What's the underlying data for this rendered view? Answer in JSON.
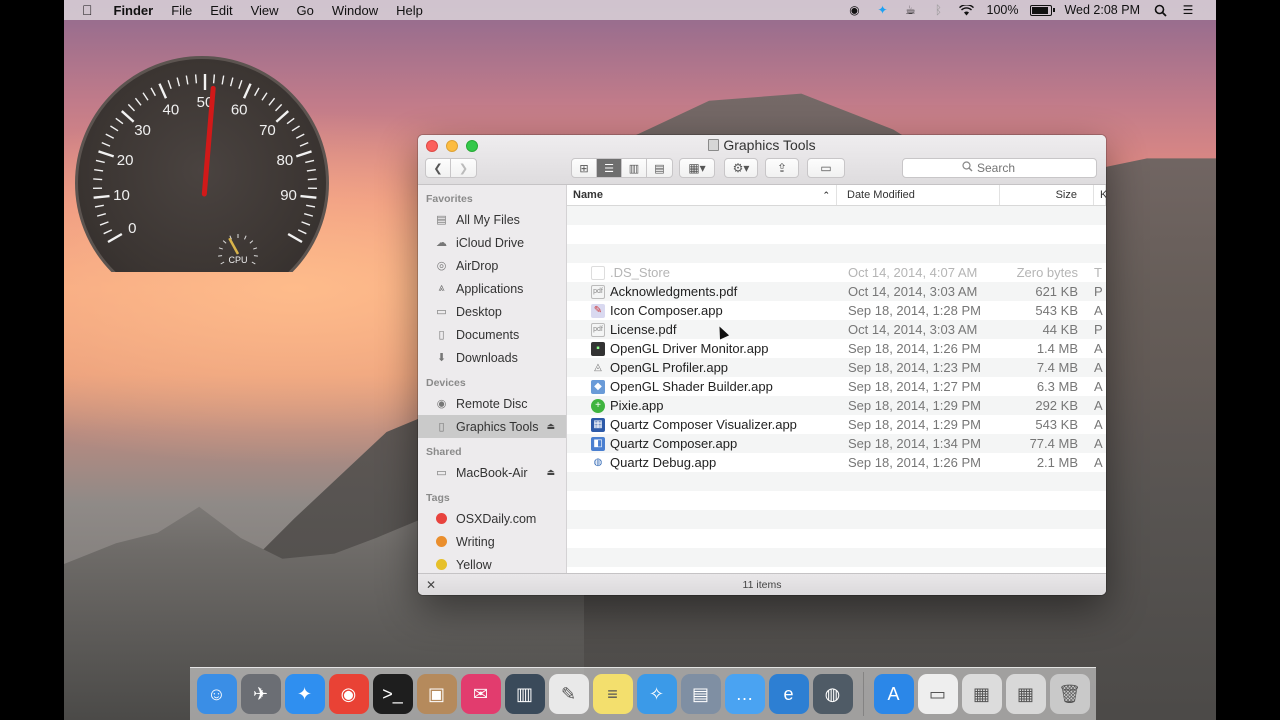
{
  "menubar": {
    "apple": "",
    "app": "Finder",
    "items": [
      "File",
      "Edit",
      "View",
      "Go",
      "Window",
      "Help"
    ],
    "battery": "100%",
    "clock": "Wed 2:08 PM"
  },
  "gauge": {
    "ticks": [
      "0",
      "10",
      "20",
      "30",
      "40",
      "50",
      "60",
      "70",
      "80",
      "90"
    ],
    "needle_value": 52,
    "sub_label": "CPU"
  },
  "finder": {
    "title": "Graphics Tools",
    "search_placeholder": "Search",
    "sidebar": {
      "favorites_header": "Favorites",
      "favorites": [
        {
          "label": "All My Files",
          "icon": "all-files-icon"
        },
        {
          "label": "iCloud Drive",
          "icon": "cloud-icon"
        },
        {
          "label": "AirDrop",
          "icon": "airdrop-icon"
        },
        {
          "label": "Applications",
          "icon": "applications-icon"
        },
        {
          "label": "Desktop",
          "icon": "desktop-icon"
        },
        {
          "label": "Documents",
          "icon": "documents-icon"
        },
        {
          "label": "Downloads",
          "icon": "downloads-icon"
        }
      ],
      "devices_header": "Devices",
      "devices": [
        {
          "label": "Remote Disc",
          "icon": "disc-icon"
        },
        {
          "label": "Graphics Tools",
          "icon": "disk-image-icon"
        }
      ],
      "shared_header": "Shared",
      "shared": [
        {
          "label": "MacBook-Air",
          "icon": "computer-icon"
        }
      ],
      "tags_header": "Tags",
      "tags": [
        {
          "label": "OSXDaily.com",
          "color": "#e8433e"
        },
        {
          "label": "Writing",
          "color": "#ea8e2d"
        },
        {
          "label": "Yellow",
          "color": "#e6c02a"
        }
      ]
    },
    "columns": {
      "name": "Name",
      "date": "Date Modified",
      "size": "Size",
      "kind": "K"
    },
    "files": [
      {
        "name": ".DS_Store",
        "date": "Oct 14, 2014, 4:07 AM",
        "size": "Zero bytes",
        "kind": "T"
      },
      {
        "name": "Acknowledgments.pdf",
        "date": "Oct 14, 2014, 3:03 AM",
        "size": "621 KB",
        "kind": "P"
      },
      {
        "name": "Icon Composer.app",
        "date": "Sep 18, 2014, 1:28 PM",
        "size": "543 KB",
        "kind": "A"
      },
      {
        "name": "License.pdf",
        "date": "Oct 14, 2014, 3:03 AM",
        "size": "44 KB",
        "kind": "P"
      },
      {
        "name": "OpenGL Driver Monitor.app",
        "date": "Sep 18, 2014, 1:26 PM",
        "size": "1.4 MB",
        "kind": "A"
      },
      {
        "name": "OpenGL Profiler.app",
        "date": "Sep 18, 2014, 1:23 PM",
        "size": "7.4 MB",
        "kind": "A"
      },
      {
        "name": "OpenGL Shader Builder.app",
        "date": "Sep 18, 2014, 1:27 PM",
        "size": "6.3 MB",
        "kind": "A"
      },
      {
        "name": "Pixie.app",
        "date": "Sep 18, 2014, 1:29 PM",
        "size": "292 KB",
        "kind": "A"
      },
      {
        "name": "Quartz Composer Visualizer.app",
        "date": "Sep 18, 2014, 1:29 PM",
        "size": "543 KB",
        "kind": "A"
      },
      {
        "name": "Quartz Composer.app",
        "date": "Sep 18, 2014, 1:34 PM",
        "size": "77.4 MB",
        "kind": "A"
      },
      {
        "name": "Quartz Debug.app",
        "date": "Sep 18, 2014, 1:26 PM",
        "size": "2.1 MB",
        "kind": "A"
      }
    ],
    "status": "11 items"
  },
  "dock": {
    "apps": [
      {
        "name": "finder",
        "color": "#3a8ee6",
        "glyph": "☺"
      },
      {
        "name": "launchpad",
        "color": "#6b6e74",
        "glyph": "✈"
      },
      {
        "name": "safari",
        "color": "#2f8ff0",
        "glyph": "✦"
      },
      {
        "name": "chrome",
        "color": "#e94235",
        "glyph": "◉"
      },
      {
        "name": "terminal",
        "color": "#1e1e1e",
        "glyph": ">_"
      },
      {
        "name": "preview",
        "color": "#b58a5c",
        "glyph": "▣"
      },
      {
        "name": "airmail",
        "color": "#e23c6e",
        "glyph": "✉"
      },
      {
        "name": "activity-monitor",
        "color": "#3a4a5a",
        "glyph": "▥"
      },
      {
        "name": "textedit",
        "color": "#e9e9e9",
        "glyph": "✎"
      },
      {
        "name": "notes",
        "color": "#f3df6d",
        "glyph": "≡"
      },
      {
        "name": "twitter",
        "color": "#3b9ae8",
        "glyph": "✧"
      },
      {
        "name": "image-capture",
        "color": "#7f8fa3",
        "glyph": "▤"
      },
      {
        "name": "messages",
        "color": "#4aa3f2",
        "glyph": "…"
      },
      {
        "name": "edge-browser",
        "color": "#2d7fd3",
        "glyph": "e"
      },
      {
        "name": "quartz-debug",
        "color": "#4f5b66",
        "glyph": "◍"
      },
      {
        "name": "app-store",
        "color": "#2b87e8",
        "glyph": "A"
      },
      {
        "name": "document",
        "color": "#eeeeee",
        "glyph": "▭"
      },
      {
        "name": "window-preview-1",
        "color": "#dcdcdc",
        "glyph": "▦"
      },
      {
        "name": "window-preview-2",
        "color": "#d8d8d8",
        "glyph": "▦"
      },
      {
        "name": "trash",
        "color": "#c9c9c9",
        "glyph": "🗑"
      }
    ]
  }
}
